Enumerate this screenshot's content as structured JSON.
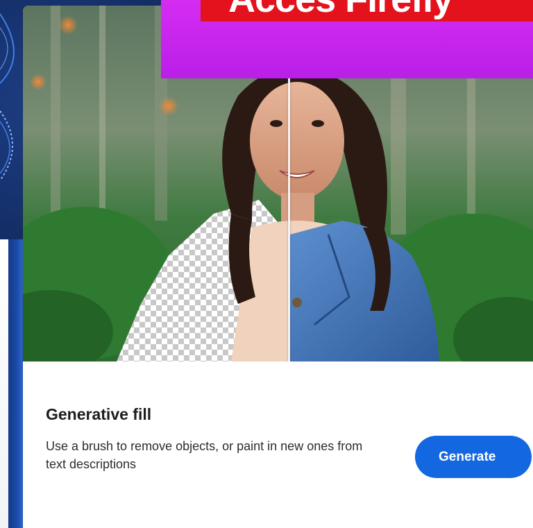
{
  "banner": {
    "partial_text": "Acces Firefly"
  },
  "feature_card": {
    "title": "Generative fill",
    "description": "Use a brush to remove objects, or paint in new ones from text descriptions",
    "generate_label": "Generate"
  },
  "colors": {
    "button_blue": "#1367e1",
    "banner_magenta": "#c926ee",
    "banner_red": "#e3121d"
  }
}
